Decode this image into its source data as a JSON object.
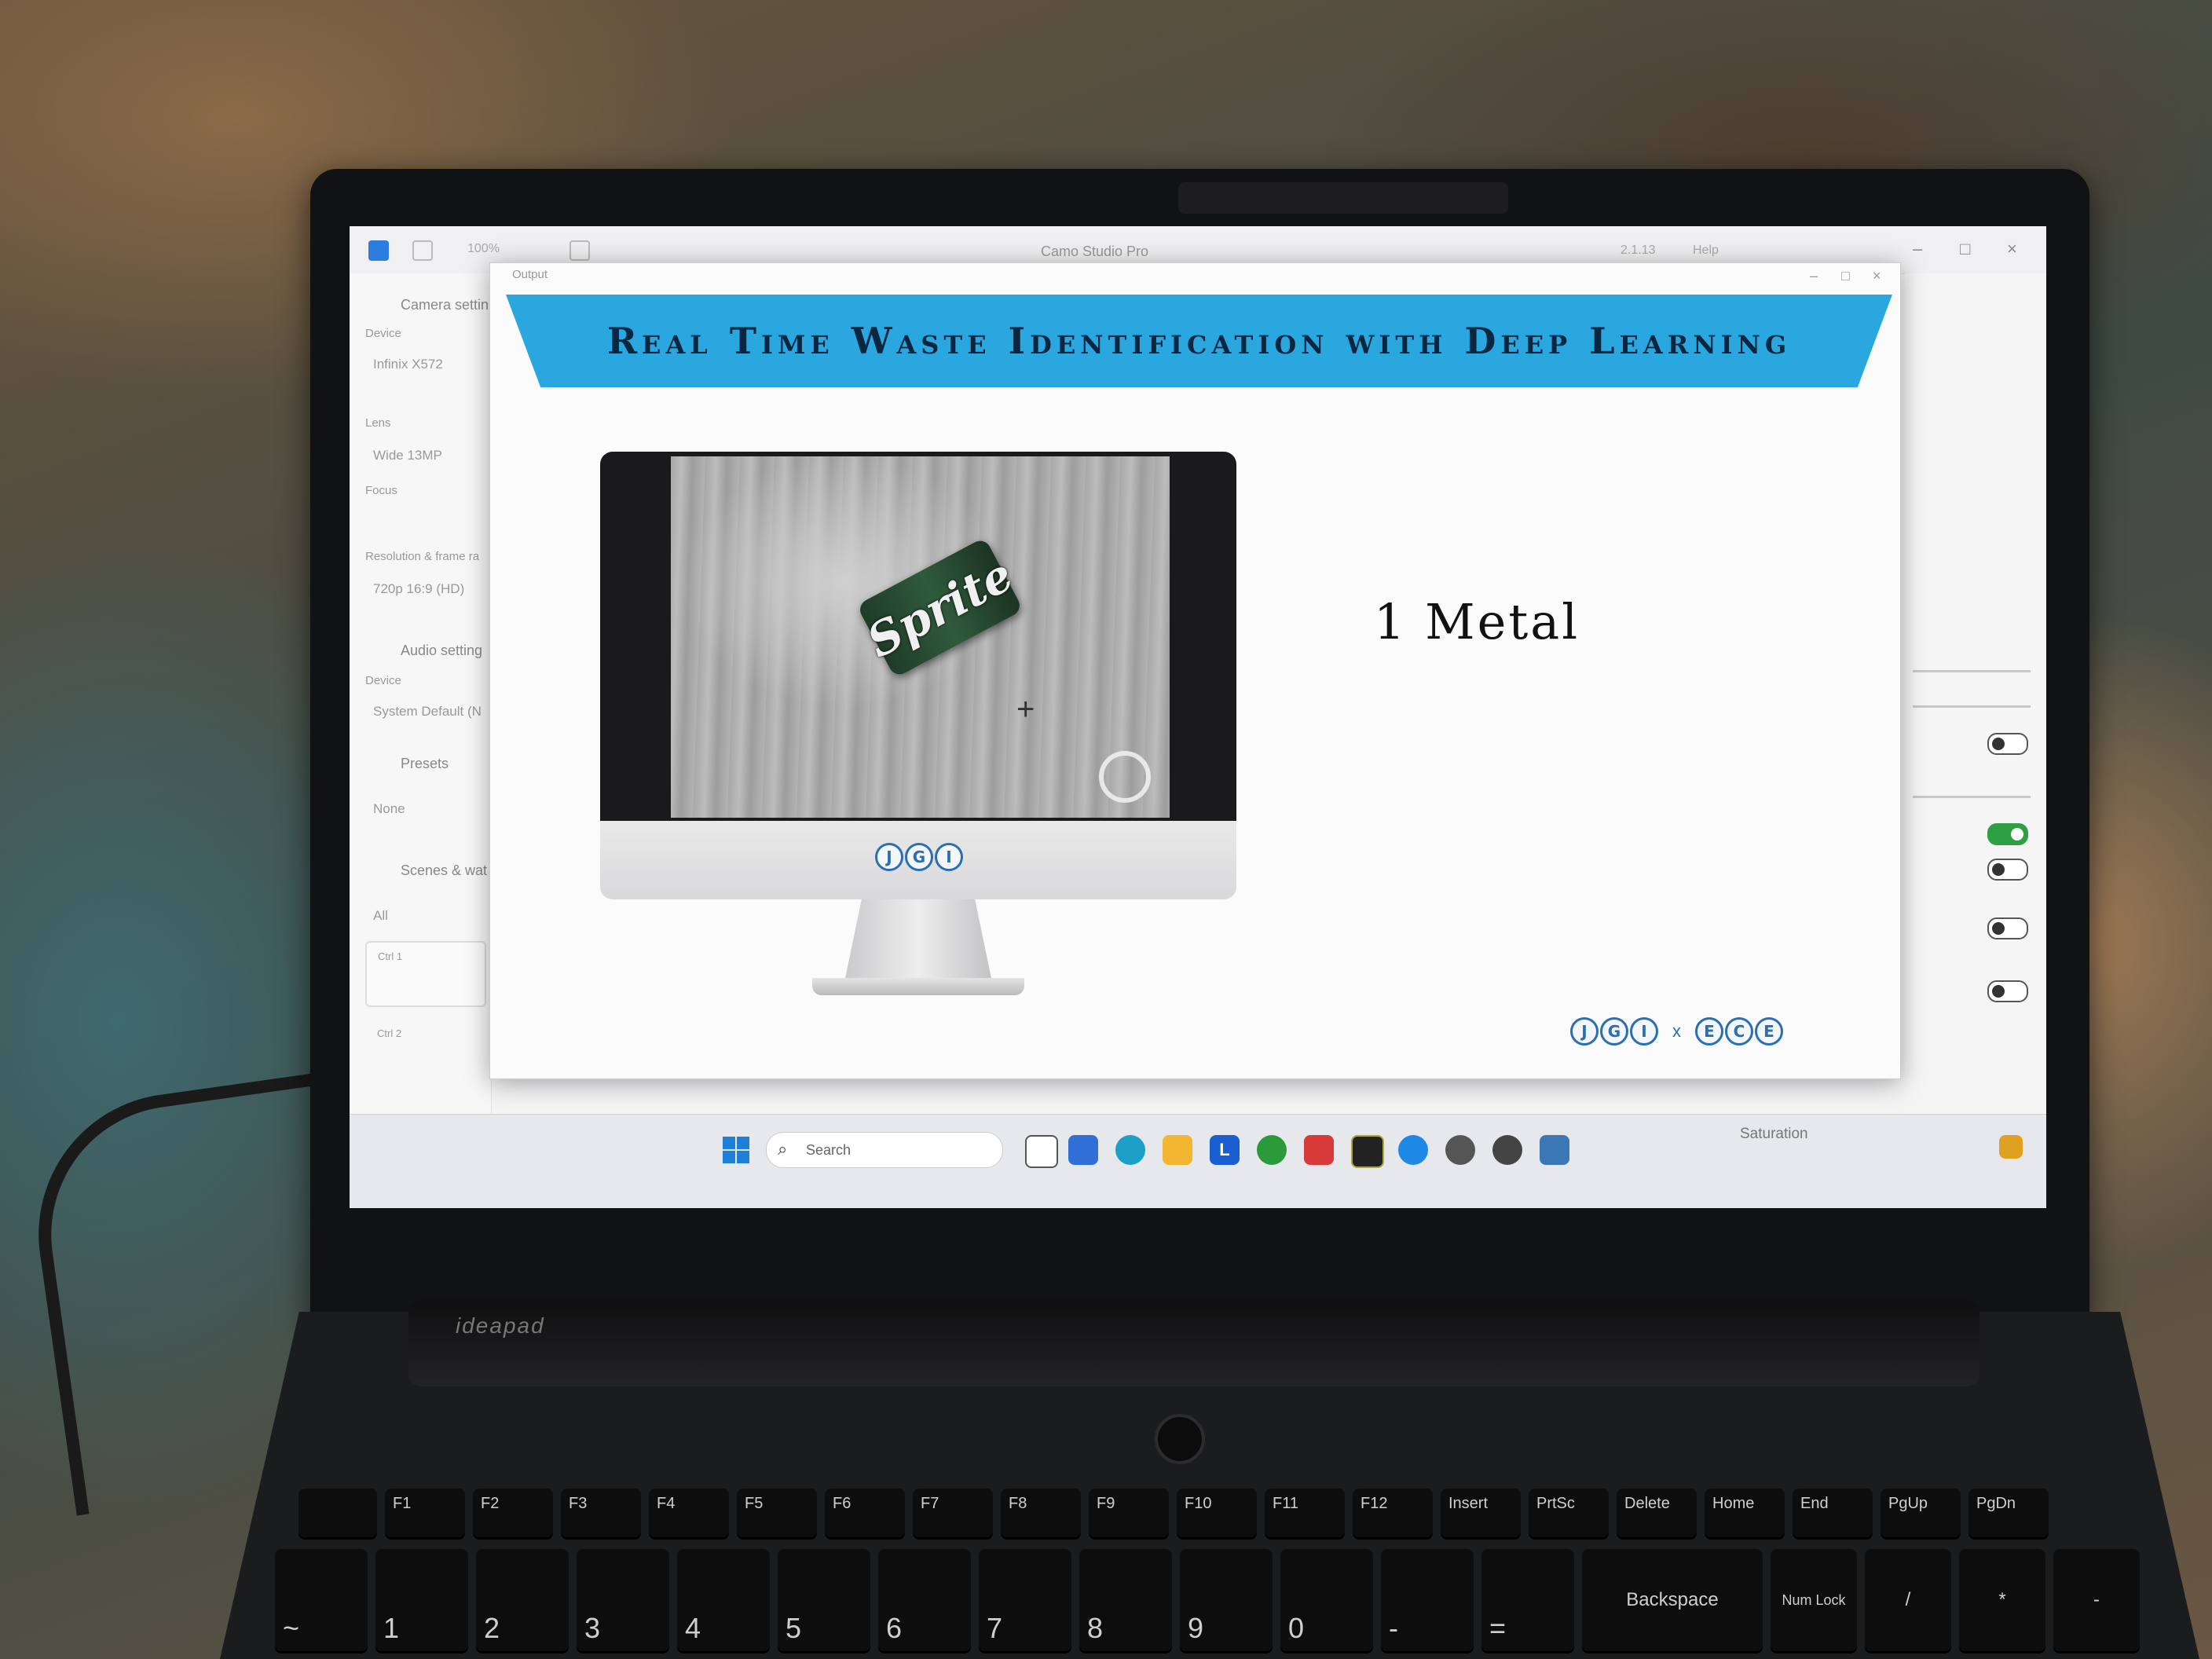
{
  "camo": {
    "title": "Camo Studio Pro",
    "zoom": "100%",
    "version": "2.1.13",
    "help": "Help",
    "sidebar": {
      "camera_settings": "Camera settin",
      "device_label": "Device",
      "device_value": "Infinix X572",
      "lens_label": "Lens",
      "lens_value": "Wide 13MP",
      "focus_label": "Focus",
      "resolution_label": "Resolution & frame ra",
      "resolution_value": "720p 16:9 (HD)",
      "audio_settings": "Audio setting",
      "audio_device_label": "Device",
      "audio_device_value": "System Default (N",
      "presets": "Presets",
      "presets_value": "None",
      "scenes": "Scenes & wat",
      "scenes_filter": "All",
      "scene_1_shortcut": "Ctrl 1",
      "scene_2_shortcut": "Ctrl 2"
    },
    "right_panel": {
      "saturation_label": "Saturation"
    }
  },
  "output_window": {
    "title": "Output",
    "banner_title": "Real Time Waste Identification with Deep Learning",
    "prediction": "1 Metal",
    "can_brand": "Sprite",
    "monitor_logo": [
      "J",
      "G",
      "I"
    ],
    "footer_logo_left": [
      "J",
      "G",
      "I"
    ],
    "footer_separator": "x",
    "footer_logo_right": [
      "E",
      "C",
      "E"
    ],
    "colors": {
      "banner": "#2aa7df",
      "logo": "#2b6fb3"
    }
  },
  "taskbar": {
    "search_placeholder": "Search",
    "pinned_letter": "L"
  },
  "laptop": {
    "brand": "ideapad",
    "fn_keys": [
      "F1",
      "F2",
      "F3",
      "F4",
      "F5",
      "F6",
      "F7",
      "F8",
      "F9",
      "F10",
      "F11",
      "F12",
      "Insert",
      "PrtSc",
      "Delete",
      "Home",
      "End",
      "PgUp",
      "PgDn"
    ],
    "number_keys": [
      "~",
      "!",
      "@",
      "#",
      "$",
      "%",
      "^",
      "&",
      "*",
      "(",
      ")",
      "—",
      "+"
    ],
    "number_keys_bottom": [
      "`",
      "1",
      "2",
      "3",
      "4",
      "5",
      "6",
      "7",
      "8",
      "9",
      "0",
      "-",
      "="
    ],
    "backspace": "Backspace",
    "numlock": "Num Lock",
    "slash": "/",
    "star": "*",
    "minus": "-"
  }
}
